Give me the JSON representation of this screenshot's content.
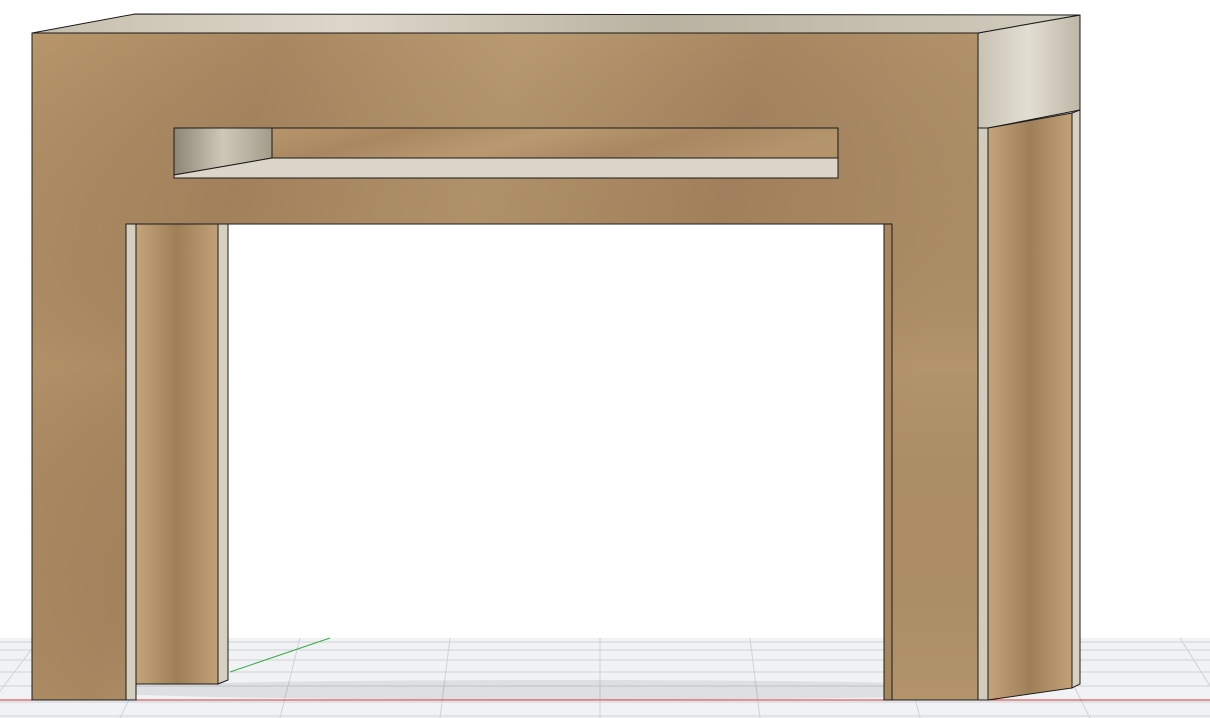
{
  "viewport": {
    "type": "3d-model-view",
    "model": "console-table",
    "background_color": "#ffffff",
    "grid": true,
    "grid_color": "#c9ccd1",
    "axes": {
      "x_color": "#d03a3a",
      "y_color": "#3aa84a"
    },
    "materials": {
      "wood_face": "#b08f66",
      "wood_light": "#c9a87e",
      "wood_dark": "#8f7250",
      "end_grain": "#d8d2c4",
      "end_grain_dark": "#a9a190",
      "edge_line": "#1a1a1a"
    }
  }
}
